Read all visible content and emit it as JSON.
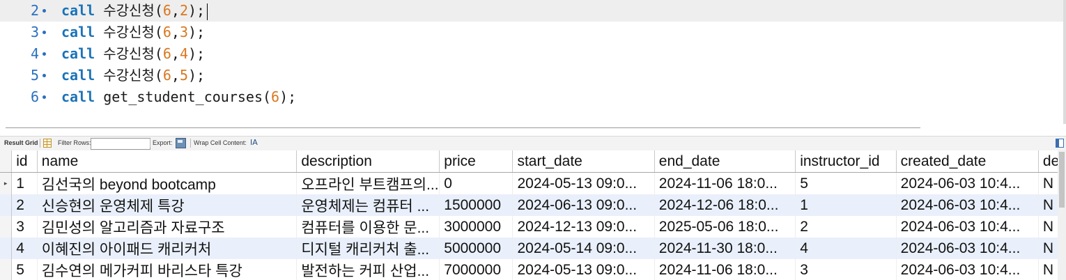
{
  "editor": {
    "lines": [
      {
        "num": "2",
        "kw": "call",
        "name": "수강신청",
        "args": [
          "6",
          "2"
        ],
        "current": true
      },
      {
        "num": "3",
        "kw": "call",
        "name": "수강신청",
        "args": [
          "6",
          "3"
        ]
      },
      {
        "num": "4",
        "kw": "call",
        "name": "수강신청",
        "args": [
          "6",
          "4"
        ]
      },
      {
        "num": "5",
        "kw": "call",
        "name": "수강신청",
        "args": [
          "6",
          "5"
        ]
      },
      {
        "num": "6",
        "kw": "call",
        "name": "get_student_courses",
        "args": [
          "6"
        ]
      }
    ]
  },
  "toolbar": {
    "result_grid": "Result Grid",
    "filter_rows": "Filter Rows:",
    "filter_value": "",
    "export": "Export:",
    "wrap_cell_content": "Wrap Cell Content:",
    "wrap_icon_glyph": "IA"
  },
  "grid": {
    "columns": [
      "id",
      "name",
      "description",
      "price",
      "start_date",
      "end_date",
      "instructor_id",
      "created_date",
      "de"
    ],
    "rows": [
      [
        "1",
        "김선국의 beyond bootcamp",
        "오프라인 부트캠프의...",
        "0",
        "2024-05-13 09:0...",
        "2024-11-06 18:0...",
        "5",
        "2024-06-03 10:4...",
        "N"
      ],
      [
        "2",
        "신승현의 운영체제 특강",
        "운영체제는 컴퓨터 ...",
        "1500000",
        "2024-06-13 09:0...",
        "2024-12-06 18:0...",
        "1",
        "2024-06-03 10:4...",
        "N"
      ],
      [
        "3",
        "김민성의 알고리즘과 자료구조",
        "컴퓨터를 이용한 문...",
        "3000000",
        "2024-12-13 09:0...",
        "2025-05-06 18:0...",
        "2",
        "2024-06-03 10:4...",
        "N"
      ],
      [
        "4",
        "이혜진의 아이패드 캐리커처",
        "디지털 캐리커처 출...",
        "5000000",
        "2024-05-14 09:0...",
        "2024-11-30 18:0...",
        "4",
        "2024-06-03 10:4...",
        "N"
      ],
      [
        "5",
        "김수연의 메가커피 바리스타 특강",
        "발전하는 커피 산업...",
        "7000000",
        "2024-05-13 09:0...",
        "2024-11-06 18:0...",
        "3",
        "2024-06-03 10:4...",
        "N"
      ]
    ],
    "active_row_marker": "▸"
  }
}
